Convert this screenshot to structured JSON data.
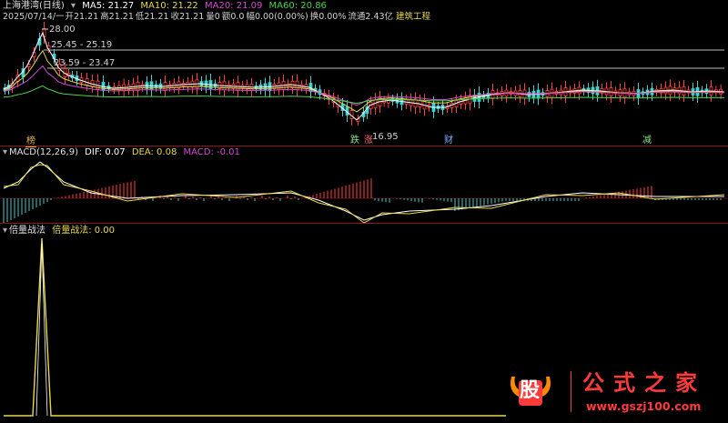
{
  "header": {
    "title": "上海港湾(日线)",
    "ma": [
      {
        "label": "MA5: 21.27",
        "color": "#ffffff"
      },
      {
        "label": "MA10: 21.22",
        "color": "#e6d84a"
      },
      {
        "label": "MA20: 21.09",
        "color": "#d24bd2"
      },
      {
        "label": "MA60: 20.86",
        "color": "#4bd24b"
      }
    ],
    "info_date": "2025/07/14/一",
    "info_items": [
      "开21.21",
      "高21.21",
      "低21.21",
      "收21.21",
      "量0",
      "额0.0",
      "幅0.00(0.00%)",
      "换0.00%",
      "流通2.43亿"
    ],
    "sector": "建筑工程"
  },
  "price_annotations": {
    "high": "28.00",
    "band1": "25.45 - 25.19",
    "band2": "23.59 - 23.47",
    "low": "16.95"
  },
  "badges": [
    {
      "text": "榜",
      "color": "#e8b04a"
    },
    {
      "text": "跌",
      "color": "#8ee08e"
    },
    {
      "text": "涨",
      "color": "#ff7070"
    },
    {
      "text": "财",
      "color": "#80b0ff"
    },
    {
      "text": "减",
      "color": "#8ee08e"
    }
  ],
  "macd": {
    "label": "MACD(12,26,9)",
    "dif": "DIF: 0.07",
    "dea": "DEA: 0.08",
    "macd": "MACD: -0.01",
    "color_dif": "#ffffff",
    "color_dea": "#e6d84a",
    "color_macd": "#d24bd2"
  },
  "indicator": {
    "label": "倍量战法",
    "value_label": "倍量战法: 0.00",
    "color": "#e6d84a"
  },
  "watermark": {
    "logo": "股",
    "text": "公式之家",
    "url": "www.gszj100.com",
    "color": "#ff3a3a"
  }
}
